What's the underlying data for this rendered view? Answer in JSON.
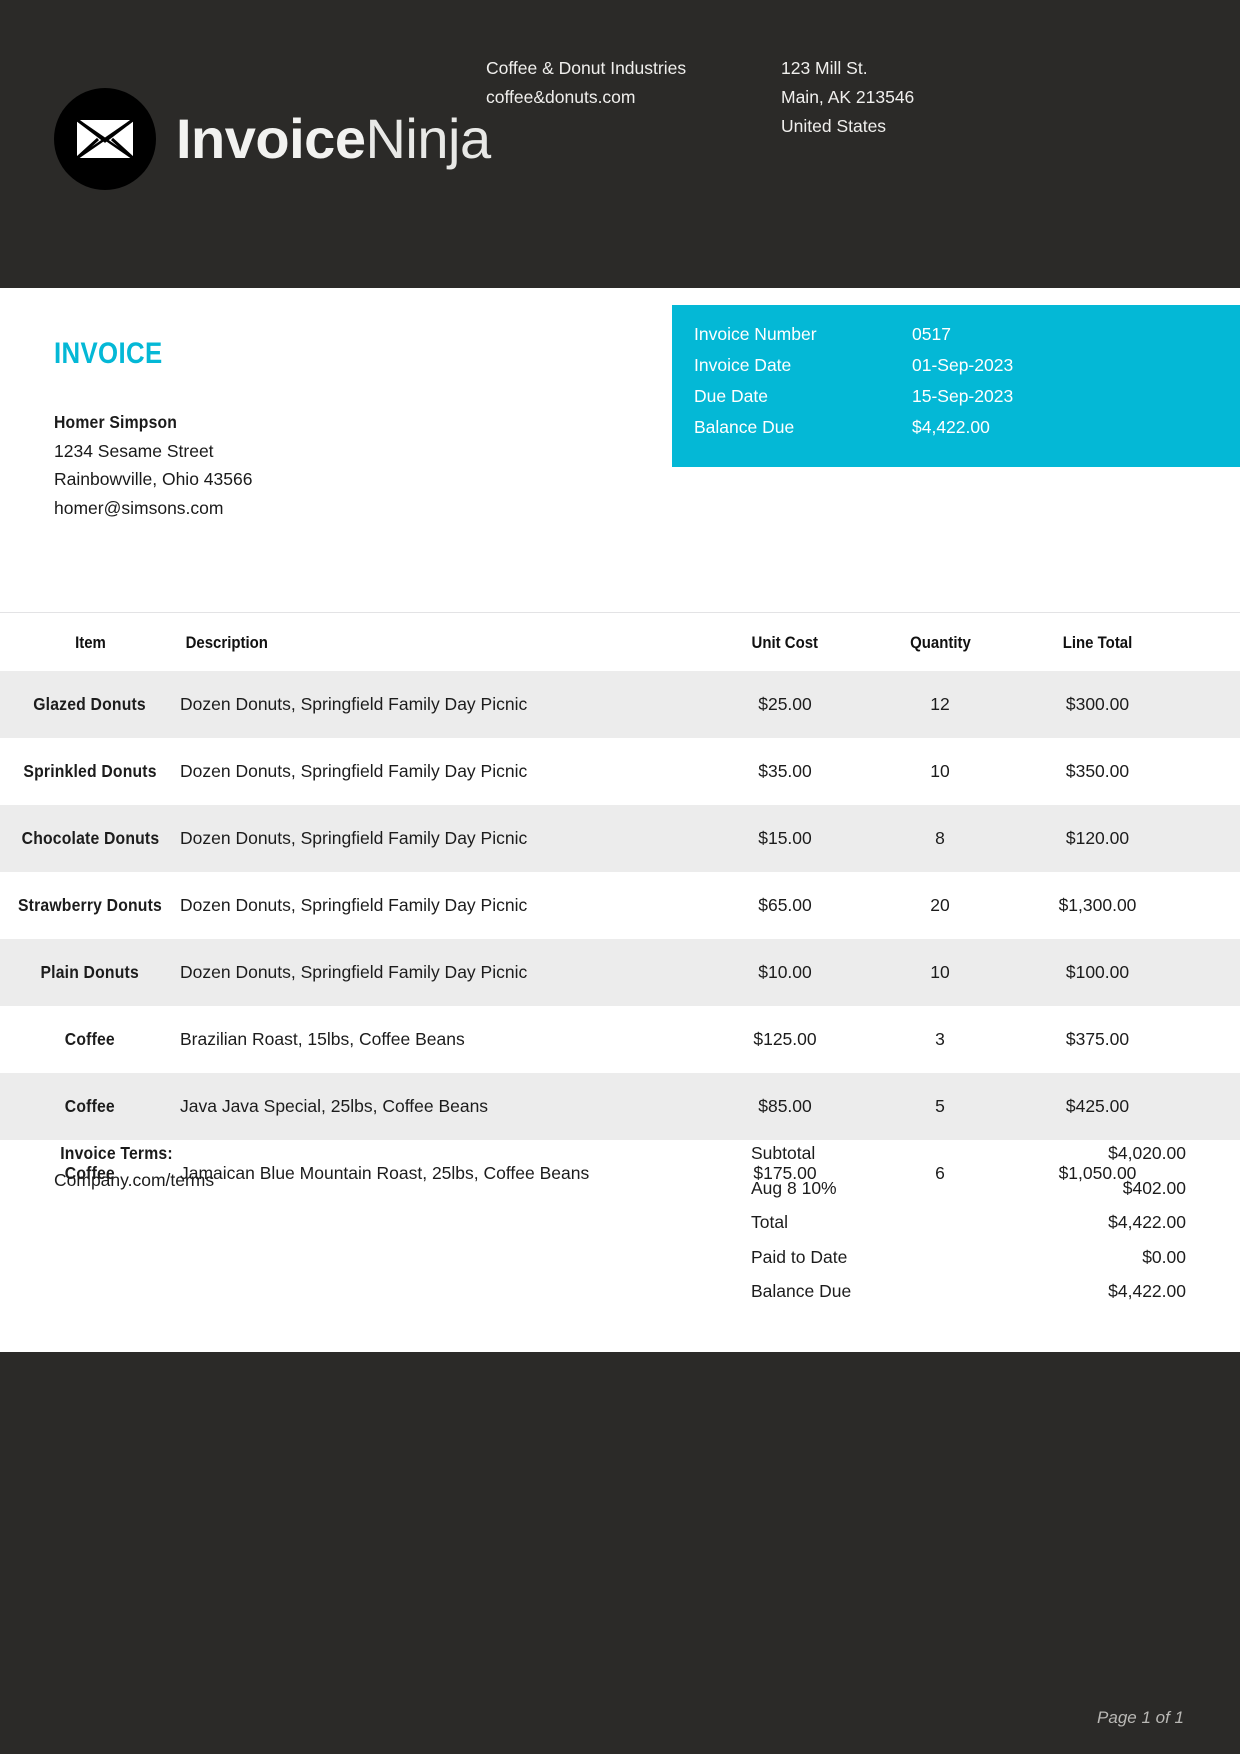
{
  "colors": {
    "header_bg": "#2b2a28",
    "accent": "#04b8d6",
    "row_alt": "#ececec",
    "page_bg": "#ffffff",
    "footer_bg": "#2b2a28"
  },
  "header": {
    "logo_name_bold": "Invoice",
    "logo_name_light": "Ninja",
    "logo_icon": "envelope-icon",
    "company": {
      "name": "Coffee & Donut Industries",
      "website": "coffee&donuts.com"
    },
    "address": {
      "line1": "123 Mill St.",
      "line2": "Main, AK 213546",
      "line3": "United States"
    }
  },
  "document": {
    "title": "INVOICE"
  },
  "client": {
    "name": "Homer Simpson",
    "street": "1234 Sesame Street",
    "city_state_zip": "Rainbowville, Ohio 43566",
    "email": "homer@simsons.com"
  },
  "meta": {
    "rows": [
      {
        "label": "Invoice Number",
        "value": "0517"
      },
      {
        "label": "Invoice Date",
        "value": "01-Sep-2023"
      },
      {
        "label": "Due Date",
        "value": "15-Sep-2023"
      },
      {
        "label": "Balance Due",
        "value": "$4,422.00"
      }
    ]
  },
  "table": {
    "columns": [
      "Item",
      "Description",
      "Unit Cost",
      "Quantity",
      "Line Total"
    ],
    "rows": [
      {
        "item": "Glazed Donuts",
        "description": "Dozen Donuts, Springfield Family Day Picnic",
        "unit_cost": "$25.00",
        "quantity": "12",
        "line_total": "$300.00"
      },
      {
        "item": "Sprinkled Donuts",
        "description": "Dozen Donuts, Springfield Family Day Picnic",
        "unit_cost": "$35.00",
        "quantity": "10",
        "line_total": "$350.00"
      },
      {
        "item": "Chocolate Donuts",
        "description": "Dozen Donuts, Springfield Family Day Picnic",
        "unit_cost": "$15.00",
        "quantity": "8",
        "line_total": "$120.00"
      },
      {
        "item": "Strawberry Donuts",
        "description": "Dozen Donuts, Springfield Family Day Picnic",
        "unit_cost": "$65.00",
        "quantity": "20",
        "line_total": "$1,300.00"
      },
      {
        "item": "Plain Donuts",
        "description": "Dozen Donuts, Springfield Family Day Picnic",
        "unit_cost": "$10.00",
        "quantity": "10",
        "line_total": "$100.00"
      },
      {
        "item": "Coffee",
        "description": "Brazilian Roast, 15lbs, Coffee Beans",
        "unit_cost": "$125.00",
        "quantity": "3",
        "line_total": "$375.00"
      },
      {
        "item": "Coffee",
        "description": "Java Java Special, 25lbs, Coffee Beans",
        "unit_cost": "$85.00",
        "quantity": "5",
        "line_total": "$425.00"
      },
      {
        "item": "Coffee",
        "description": "Jamaican Blue Mountain Roast, 25lbs, Coffee Beans",
        "unit_cost": "$175.00",
        "quantity": "6",
        "line_total": "$1,050.00"
      }
    ]
  },
  "terms": {
    "title": "Invoice Terms:",
    "body": "Company.com/terms"
  },
  "totals": {
    "rows": [
      {
        "label": "Subtotal",
        "value": "$4,020.00"
      },
      {
        "label": "Aug 8 10%",
        "value": "$402.00"
      },
      {
        "label": "Total",
        "value": "$4,422.00"
      },
      {
        "label": "Paid to Date",
        "value": "$0.00"
      },
      {
        "label": "Balance Due",
        "value": "$4,422.00"
      }
    ]
  },
  "footer": {
    "page_number": "Page 1 of 1"
  }
}
